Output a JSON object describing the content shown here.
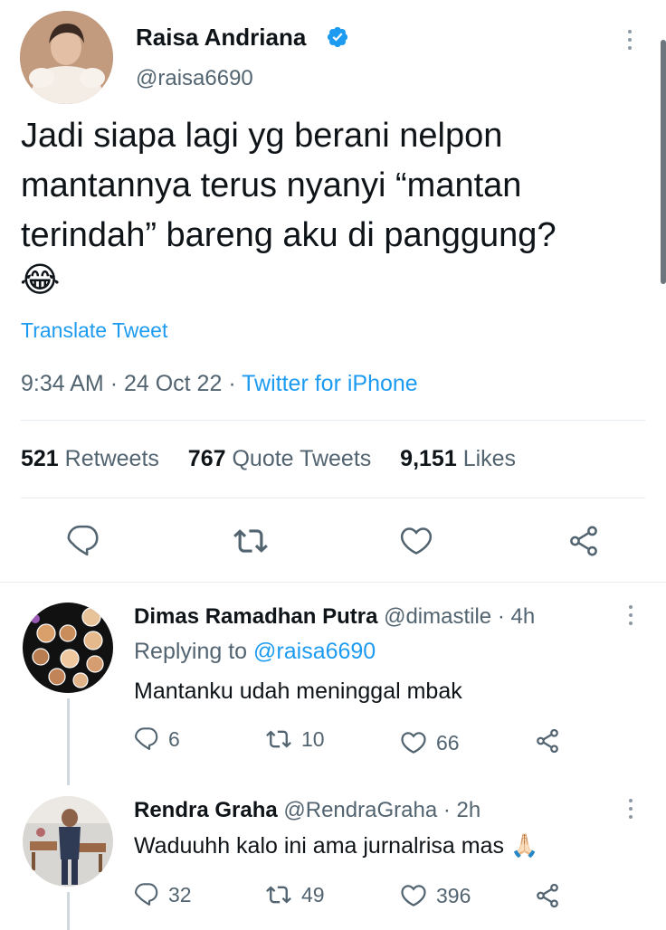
{
  "tweet": {
    "author_name": "Raisa Andriana",
    "author_handle": "@raisa6690",
    "verified_icon": "verified-badge-icon",
    "text_lines": [
      "Jadi siapa lagi yg berani nelpon",
      "mantannya terus nyanyi “mantan",
      "terindah” bareng aku di panggung?"
    ],
    "emoji": "😂",
    "translate_label": "Translate Tweet",
    "time": "9:34 AM",
    "sep1": "·",
    "date": "24 Oct 22",
    "sep2": "·",
    "source": "Twitter for iPhone",
    "stats": {
      "retweets_count": "521",
      "retweets_label": "Retweets",
      "quotes_count": "767",
      "quotes_label": "Quote Tweets",
      "likes_count": "9,151",
      "likes_label": "Likes"
    },
    "actions": [
      "reply-icon",
      "retweet-icon",
      "like-icon",
      "share-icon"
    ]
  },
  "replies": [
    {
      "name": "Dimas Ramadhan Putra",
      "handle": "@dimastile",
      "sep": "·",
      "time": "4h",
      "replying_prefix": "Replying to",
      "replying_to": "@raisa6690",
      "text": "Mantanku udah meninggal mbak",
      "replies": "6",
      "retweets": "10",
      "likes": "66"
    },
    {
      "name": "Rendra Graha",
      "handle": "@RendraGraha",
      "sep": "·",
      "time": "2h",
      "text": "Waduuhh kalo ini ama jurnalrisa mas",
      "emoji": "🙏🏻",
      "replies": "32",
      "retweets": "49",
      "likes": "396"
    }
  ],
  "colors": {
    "link": "#1d9bf0",
    "muted": "#536471",
    "text": "#0f1419",
    "verified": "#1d9bf0",
    "divider": "#e6ecf0"
  }
}
